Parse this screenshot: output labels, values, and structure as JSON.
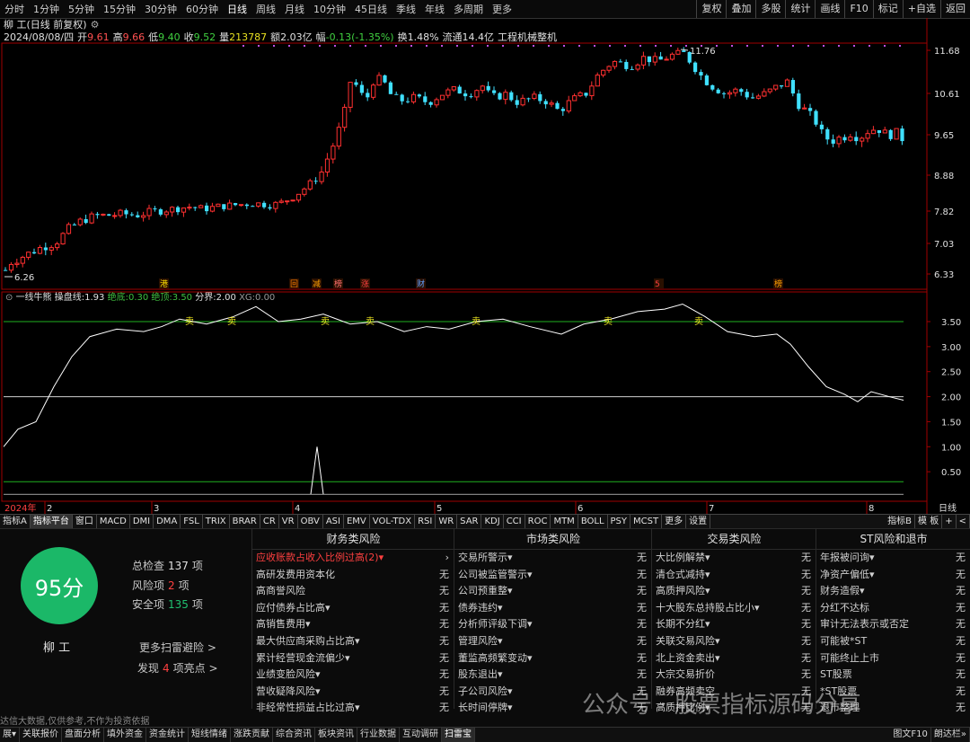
{
  "periods": [
    "分时",
    "1分钟",
    "5分钟",
    "15分钟",
    "30分钟",
    "60分钟",
    "日线",
    "周线",
    "月线",
    "10分钟",
    "45日线",
    "季线",
    "年线",
    "多周期",
    "更多"
  ],
  "active_period": "日线",
  "right_buttons": [
    "复权",
    "叠加",
    "多股",
    "统计",
    "画线",
    "F10",
    "标记",
    "+自选",
    "返回"
  ],
  "title": "柳 工(日线 前复权)",
  "quote": {
    "date": "2024/08/08/四",
    "open_label": "开",
    "open": "9.61",
    "high_label": "高",
    "high": "9.66",
    "low_label": "低",
    "low": "9.40",
    "close_label": "收",
    "close": "9.52",
    "vol_label": "量",
    "vol": "213787",
    "amt_label": "额",
    "amt": "2.03亿",
    "chg_label": "幅",
    "chg": "-0.13(-1.35%)",
    "turn_label": "换",
    "turn": "1.48%",
    "float_label": "流通",
    "float": "14.4亿",
    "industry": "工程机械整机"
  },
  "price_axis": [
    "11.68",
    "10.61",
    "9.65",
    "8.88",
    "7.82",
    "7.03",
    "6.33"
  ],
  "price_extremes": {
    "high": "11.76",
    "low": "6.26"
  },
  "event_markers": [
    "港",
    "回",
    "减",
    "榜",
    "涨",
    "财",
    "5",
    "榜"
  ],
  "indicator": {
    "name": "一线牛熊",
    "l1": "操盘线:",
    "v1": "1.93",
    "l2": "绝底:",
    "v2": "0.30",
    "l3": "绝顶:",
    "v3": "3.50",
    "l4": "分界:",
    "v4": "2.00",
    "l5": "XG:",
    "v5": "0.00",
    "axis": [
      "3.50",
      "3.00",
      "2.50",
      "2.00",
      "1.50",
      "1.00",
      "0.50"
    ],
    "sell_label": "卖",
    "sell_count": 7
  },
  "time_axis": {
    "year": "2024年",
    "months": [
      "2",
      "3",
      "4",
      "5",
      "6",
      "7",
      "8"
    ],
    "right": "日线"
  },
  "tabs": [
    "指标A",
    "指标平台",
    "窗口",
    "MACD",
    "DMI",
    "DMA",
    "FSL",
    "TRIX",
    "BRAR",
    "CR",
    "VR",
    "OBV",
    "ASI",
    "EMV",
    "VOL-TDX",
    "RSI",
    "WR",
    "SAR",
    "KDJ",
    "CCI",
    "ROC",
    "MTM",
    "BOLL",
    "PSY",
    "MCST",
    "更多",
    "设置"
  ],
  "active_tab": "指标平台",
  "right_tabs": [
    "指标B",
    "模 板",
    "+",
    "<"
  ],
  "risk": {
    "score": "95分",
    "stock_name": "柳 工",
    "total_label": "总检查",
    "total": "137",
    "risk_label": "风险项",
    "risk": "2",
    "safe_label": "安全项",
    "safe": "135",
    "unit": "项",
    "more": "更多扫雷避险 >",
    "find_pre": "发现",
    "find_n": "4",
    "find_post": "项亮点 >",
    "disclaimer": "达信大数据,仅供参考,不作为投资依据",
    "columns": [
      {
        "title": "财务类风险",
        "items": [
          {
            "label": "应收账款占收入比例过高(2)▾",
            "status": "›",
            "alert": true
          },
          {
            "label": "高研发费用资本化",
            "status": "无"
          },
          {
            "label": "高商誉风险",
            "status": "无"
          },
          {
            "label": "应付债券占比高▾",
            "status": "无"
          },
          {
            "label": "高销售费用▾",
            "status": "无"
          },
          {
            "label": "最大供应商采购占比高▾",
            "status": "无"
          },
          {
            "label": "累计经营现金流偏少▾",
            "status": "无"
          },
          {
            "label": "业绩变脸风险▾",
            "status": "无"
          },
          {
            "label": "营收疑降风险▾",
            "status": "无"
          },
          {
            "label": "非经常性损益占比过高▾",
            "status": "无"
          }
        ]
      },
      {
        "title": "市场类风险",
        "items": [
          {
            "label": "交易所警示▾",
            "status": "无"
          },
          {
            "label": "公司被监管警示▾",
            "status": "无"
          },
          {
            "label": "公司预重整▾",
            "status": "无"
          },
          {
            "label": "债券违约▾",
            "status": "无"
          },
          {
            "label": "分析师评级下调▾",
            "status": "无"
          },
          {
            "label": "管理风险▾",
            "status": "无"
          },
          {
            "label": "董监高频繁变动▾",
            "status": "无"
          },
          {
            "label": "股东退出▾",
            "status": "无"
          },
          {
            "label": "子公司风险▾",
            "status": "无"
          },
          {
            "label": "长时间停牌▾",
            "status": "无"
          }
        ]
      },
      {
        "title": "交易类风险",
        "items": [
          {
            "label": "大比例解禁▾",
            "status": "无"
          },
          {
            "label": "清仓式减持▾",
            "status": "无"
          },
          {
            "label": "高质押风险▾",
            "status": "无"
          },
          {
            "label": "十大股东总持股占比小▾",
            "status": "无"
          },
          {
            "label": "长期不分红▾",
            "status": "无"
          },
          {
            "label": "关联交易风险▾",
            "status": "无"
          },
          {
            "label": "北上资金卖出▾",
            "status": "无"
          },
          {
            "label": "大宗交易折价",
            "status": "无"
          },
          {
            "label": "融券高频卖空",
            "status": "无"
          },
          {
            "label": "高质押比例▾",
            "status": "无"
          }
        ]
      },
      {
        "title": "ST风险和退市",
        "items": [
          {
            "label": "年报被问询▾",
            "status": "无"
          },
          {
            "label": "净资产偏低▾",
            "status": "无"
          },
          {
            "label": "财务造假▾",
            "status": "无"
          },
          {
            "label": "分红不达标",
            "status": "无"
          },
          {
            "label": "审计无法表示或否定",
            "status": "无"
          },
          {
            "label": "可能被*ST",
            "status": "无"
          },
          {
            "label": "可能终止上市",
            "status": "无"
          },
          {
            "label": "ST股票",
            "status": "无"
          },
          {
            "label": "*ST股票",
            "status": "无"
          },
          {
            "label": "退市整理",
            "status": "无"
          }
        ]
      }
    ]
  },
  "watermark": "公众号 · 股票指标源码分享",
  "status_tabs": [
    "展▾",
    "关联报价",
    "盘面分析",
    "填外资金",
    "资金统计",
    "短线情绪",
    "涨跌贡献",
    "综合资讯",
    "板块资讯",
    "行业数据",
    "互动调研",
    "扫雷宝"
  ],
  "active_status": "扫雷宝",
  "status_right": [
    "图文F10",
    "朗达栏»"
  ],
  "colors": {
    "up": "#ff3030",
    "down": "#40e0ff",
    "ma": "#e0e0e0",
    "grid_red": "#a00000",
    "green": "#20b020",
    "score": "#1bb868"
  }
}
